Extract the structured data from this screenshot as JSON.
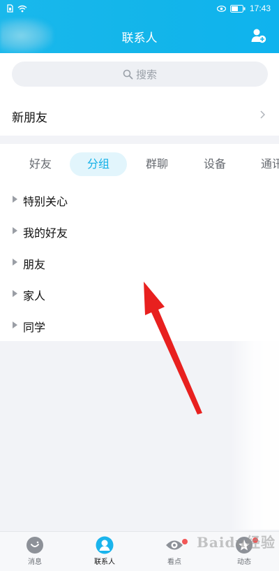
{
  "status_bar": {
    "time": "17:43"
  },
  "header": {
    "title": "联系人"
  },
  "search": {
    "placeholder": "搜索"
  },
  "new_friends": {
    "label": "新朋友"
  },
  "tabs": [
    {
      "label": "好友",
      "active": false
    },
    {
      "label": "分组",
      "active": true
    },
    {
      "label": "群聊",
      "active": false
    },
    {
      "label": "设备",
      "active": false
    },
    {
      "label": "通讯",
      "active": false
    }
  ],
  "groups": [
    {
      "label": "特别关心"
    },
    {
      "label": "我的好友"
    },
    {
      "label": "朋友"
    },
    {
      "label": "家人"
    },
    {
      "label": "同学"
    }
  ],
  "bottom_nav": [
    {
      "label": "消息",
      "icon": "message-icon",
      "active": false
    },
    {
      "label": "联系人",
      "icon": "contacts-icon",
      "active": true
    },
    {
      "label": "看点",
      "icon": "eye-icon",
      "active": false,
      "badge": true
    },
    {
      "label": "动态",
      "icon": "star-icon",
      "active": false,
      "badge": true
    }
  ],
  "watermark": {
    "text": "Baidu经验"
  },
  "colors": {
    "accent": "#12b0e7",
    "header": "#19b8ec",
    "badge": "#f25757",
    "annotation": "#e8201f"
  }
}
